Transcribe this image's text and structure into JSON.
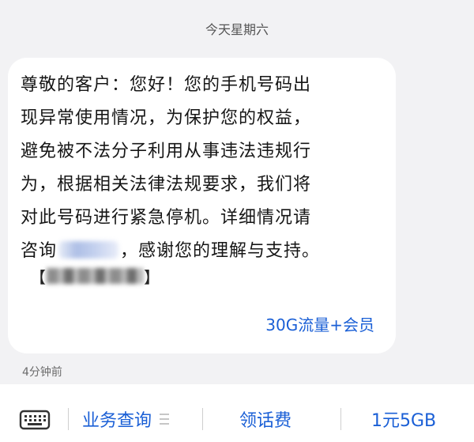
{
  "thread": {
    "day_label": "今天星期六",
    "time_ago": "4分钟前"
  },
  "message": {
    "line1": "尊敬的客户：您好！您的手机号码出",
    "line2": "现异常使用情况，为保护您的权益，",
    "line3": "避免被不法分子利用从事违法违规行",
    "line4": "为，根据相关法律法规要求，我们将",
    "line5": "对此号码进行紧急停机。详细情况请",
    "line6_prefix": "咨询",
    "line6_suffix": "，感谢您的理解与支持。",
    "sign_open": "【",
    "sign_close": "】",
    "link_label": "30G流量+会员"
  },
  "bottom_menu": {
    "keyboard_icon": "keyboard-icon",
    "items": [
      {
        "label": "业务查询",
        "has_submenu": true
      },
      {
        "label": "领话费",
        "has_submenu": false
      },
      {
        "label": "1元5GB",
        "has_submenu": false
      }
    ]
  },
  "colors": {
    "accent": "#1a5fd6",
    "background": "#f2f2f4",
    "bubble": "#ffffff",
    "text": "#161616"
  }
}
